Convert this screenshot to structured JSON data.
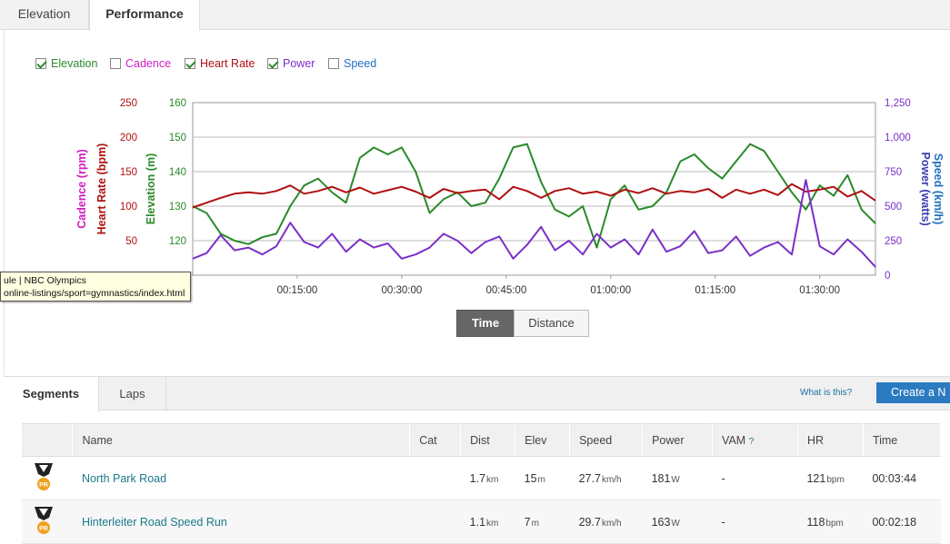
{
  "tabs": [
    {
      "label": "Elevation",
      "active": false
    },
    {
      "label": "Performance",
      "active": true
    }
  ],
  "legend": [
    {
      "label": "Elevation",
      "checked": true,
      "color": "#2a8a2a"
    },
    {
      "label": "Cadence",
      "checked": false,
      "color": "#d11fbf"
    },
    {
      "label": "Heart Rate",
      "checked": true,
      "color": "#b01010"
    },
    {
      "label": "Power",
      "checked": true,
      "color": "#7b2fc8"
    },
    {
      "label": "Speed",
      "checked": false,
      "color": "#1f6fbf"
    }
  ],
  "axes": {
    "cadence_hr_ticks": [
      "250",
      "200",
      "150",
      "100",
      "50"
    ],
    "elevation_ticks": [
      "160",
      "150",
      "140",
      "130",
      "120"
    ],
    "power_speed_ticks": [
      "1,250",
      "1,000",
      "750",
      "500",
      "250",
      "0"
    ],
    "x_ticks": [
      "00:15:00",
      "00:30:00",
      "00:45:00",
      "01:00:00",
      "01:15:00",
      "01:30:00"
    ],
    "labels": {
      "cadence": "Cadence (rpm)",
      "heart_rate": "Heart Rate (bpm)",
      "elevation": "Elevation (m)",
      "speed": "Speed (km/h)",
      "power": "Power (watts)"
    }
  },
  "tooltip": {
    "line1": "ule | NBC Olympics",
    "line2": "online-listings/sport=gymnastics/index.html"
  },
  "toggle": {
    "time": "Time",
    "distance": "Distance",
    "active": "time"
  },
  "segments_bar": {
    "tabs": [
      "Segments",
      "Laps"
    ],
    "what_is_this": "What is this?",
    "create_button": "Create a N"
  },
  "table": {
    "headers": [
      "",
      "Name",
      "Cat",
      "Dist",
      "Elev",
      "Speed",
      "Power",
      "VAM",
      "HR",
      "Time"
    ],
    "vam_help": "?",
    "rows": [
      {
        "badge": "PR",
        "name": "North Park Road",
        "cat": "",
        "dist": "1.7",
        "dist_unit": "km",
        "elev": "15",
        "elev_unit": "m",
        "speed": "27.7",
        "speed_unit": "km/h",
        "power": "181",
        "power_unit": "W",
        "vam": "-",
        "hr": "121",
        "hr_unit": "bpm",
        "time": "00:03:44"
      },
      {
        "badge": "PR",
        "name": "Hinterleiter Road Speed Run",
        "cat": "",
        "dist": "1.1",
        "dist_unit": "km",
        "elev": "7",
        "elev_unit": "m",
        "speed": "29.7",
        "speed_unit": "km/h",
        "power": "163",
        "power_unit": "W",
        "vam": "-",
        "hr": "118",
        "hr_unit": "bpm",
        "time": "00:02:18"
      }
    ]
  },
  "chart_data": {
    "type": "line",
    "x_unit": "minutes",
    "xlim": [
      0,
      98
    ],
    "series": [
      {
        "name": "Elevation",
        "color": "#2a8a2a",
        "axis": "elevation",
        "ylim": [
          110,
          160
        ],
        "x": [
          0,
          2,
          4,
          6,
          8,
          10,
          12,
          14,
          16,
          18,
          20,
          22,
          24,
          26,
          28,
          30,
          32,
          34,
          36,
          38,
          40,
          42,
          44,
          46,
          48,
          50,
          52,
          54,
          56,
          58,
          60,
          62,
          64,
          66,
          68,
          70,
          72,
          74,
          76,
          78,
          80,
          82,
          84,
          86,
          88,
          90,
          92,
          94,
          96,
          98
        ],
        "values": [
          130,
          128,
          122,
          120,
          119,
          121,
          122,
          130,
          136,
          138,
          134,
          131,
          144,
          147,
          145,
          147,
          140,
          128,
          132,
          134,
          130,
          131,
          138,
          147,
          148,
          137,
          129,
          127,
          130,
          118,
          132,
          136,
          129,
          130,
          134,
          143,
          145,
          141,
          138,
          143,
          148,
          146,
          140,
          134,
          129,
          136,
          133,
          139,
          129,
          125
        ]
      },
      {
        "name": "Heart Rate",
        "color": "#b01010",
        "axis": "heart_rate",
        "ylim": [
          0,
          250
        ],
        "x": [
          0,
          2,
          4,
          6,
          8,
          10,
          12,
          14,
          16,
          18,
          20,
          22,
          24,
          26,
          28,
          30,
          32,
          34,
          36,
          38,
          40,
          42,
          44,
          46,
          48,
          50,
          52,
          54,
          56,
          58,
          60,
          62,
          64,
          66,
          68,
          70,
          72,
          74,
          76,
          78,
          80,
          82,
          84,
          86,
          88,
          90,
          92,
          94,
          96,
          98
        ],
        "values": [
          98,
          105,
          112,
          118,
          120,
          118,
          122,
          130,
          118,
          122,
          128,
          120,
          127,
          118,
          123,
          128,
          121,
          112,
          125,
          119,
          122,
          124,
          110,
          128,
          122,
          112,
          122,
          126,
          118,
          121,
          115,
          124,
          119,
          126,
          118,
          122,
          120,
          125,
          112,
          124,
          118,
          124,
          116,
          132,
          121,
          124,
          128,
          114,
          122,
          108
        ]
      },
      {
        "name": "Power",
        "color": "#7b2fc8",
        "axis": "power",
        "ylim": [
          0,
          1250
        ],
        "x": [
          0,
          2,
          4,
          6,
          8,
          10,
          12,
          14,
          16,
          18,
          20,
          22,
          24,
          26,
          28,
          30,
          32,
          34,
          36,
          38,
          40,
          42,
          44,
          46,
          48,
          50,
          52,
          54,
          56,
          58,
          60,
          62,
          64,
          66,
          68,
          70,
          72,
          74,
          76,
          78,
          80,
          82,
          84,
          86,
          88,
          90,
          92,
          94,
          96,
          98
        ],
        "values": [
          120,
          160,
          290,
          180,
          200,
          150,
          210,
          380,
          240,
          200,
          300,
          170,
          260,
          200,
          230,
          120,
          150,
          200,
          300,
          250,
          160,
          240,
          280,
          120,
          220,
          350,
          180,
          250,
          150,
          300,
          200,
          260,
          150,
          330,
          170,
          210,
          320,
          160,
          180,
          280,
          140,
          200,
          240,
          150,
          690,
          210,
          150,
          260,
          170,
          60
        ]
      }
    ]
  }
}
